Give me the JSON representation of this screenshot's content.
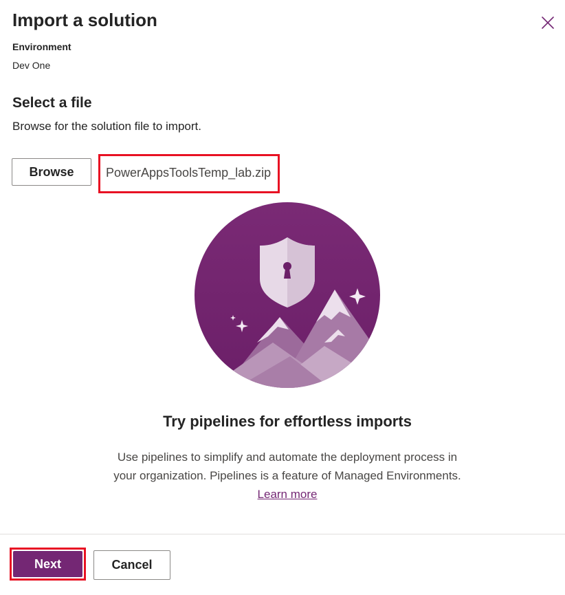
{
  "dialog": {
    "title": "Import a solution",
    "environment_label": "Environment",
    "environment_value": "Dev One"
  },
  "file_section": {
    "heading": "Select a file",
    "description": "Browse for the solution file to import.",
    "browse_label": "Browse",
    "selected_file": "PowerAppsToolsTemp_lab.zip"
  },
  "promo": {
    "title": "Try pipelines for effortless imports",
    "text_line_1": "Use pipelines to simplify and automate the deployment process in",
    "text_line_2": "your organization. Pipelines is a feature of Managed Environments.",
    "learn_more": "Learn more"
  },
  "footer": {
    "next_label": "Next",
    "cancel_label": "Cancel"
  },
  "colors": {
    "brand": "#742774",
    "highlight": "#e81123",
    "divider": "#e1dfdd"
  },
  "icons": {
    "close": "close-icon",
    "illustration": "shield-mountains-illustration"
  }
}
